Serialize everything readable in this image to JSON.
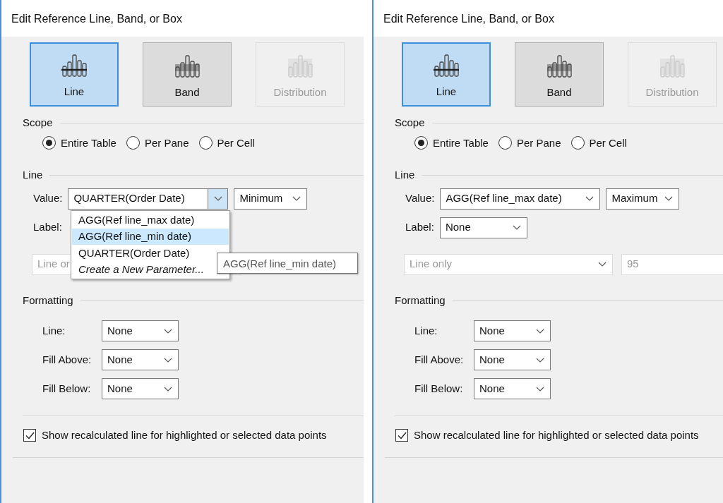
{
  "dialogs": [
    {
      "title": "Edit Reference Line, Band, or Box",
      "types": [
        {
          "kind": "line",
          "label": "Line",
          "selected": true,
          "disabled": false
        },
        {
          "kind": "band",
          "label": "Band",
          "selected": false,
          "disabled": false
        },
        {
          "kind": "distribution",
          "label": "Distribution",
          "selected": false,
          "disabled": true
        }
      ],
      "scope": {
        "title": "Scope",
        "options": [
          {
            "label": "Entire Table",
            "selected": true
          },
          {
            "label": "Per Pane",
            "selected": false
          },
          {
            "label": "Per Cell",
            "selected": false
          }
        ]
      },
      "line": {
        "title": "Line",
        "value_label": "Value:",
        "value": {
          "text": "QUARTER(Order Date)",
          "open": true
        },
        "aggregation": "Minimum",
        "label_label": "Label:",
        "menu": [
          {
            "kind": "option",
            "text": "AGG(Ref line_max date)",
            "selected": false
          },
          {
            "kind": "option",
            "text": "AGG(Ref line_min date)",
            "selected": true
          },
          {
            "kind": "option",
            "text": "QUARTER(Order Date)",
            "selected": false
          },
          {
            "kind": "action",
            "text": "Create a New Parameter...",
            "selected": false
          }
        ],
        "tooltip": "AGG(Ref line_min date)",
        "style_field": {
          "text": "Line or",
          "disabled": true
        }
      },
      "formatting": {
        "title": "Formatting",
        "rows": [
          {
            "label": "Line:",
            "value": "None"
          },
          {
            "label": "Fill Above:",
            "value": "None"
          },
          {
            "label": "Fill Below:",
            "value": "None"
          }
        ]
      },
      "recalc": {
        "label": "Show recalculated line for highlighted or selected data points",
        "checked": true
      }
    },
    {
      "title": "Edit Reference Line, Band, or Box",
      "types": [
        {
          "kind": "line",
          "label": "Line",
          "selected": true,
          "disabled": false
        },
        {
          "kind": "band",
          "label": "Band",
          "selected": false,
          "disabled": false
        },
        {
          "kind": "distribution",
          "label": "Distribution",
          "selected": false,
          "disabled": true
        }
      ],
      "scope": {
        "title": "Scope",
        "options": [
          {
            "label": "Entire Table",
            "selected": true
          },
          {
            "label": "Per Pane",
            "selected": false
          },
          {
            "label": "Per Cell",
            "selected": false
          }
        ]
      },
      "line": {
        "title": "Line",
        "value_label": "Value:",
        "value": {
          "text": "AGG(Ref line_max date)",
          "open": false
        },
        "aggregation": "Maximum",
        "label_label": "Label:",
        "label_value": "None",
        "style_field": {
          "text": "Line only",
          "disabled": true
        },
        "percent_field": {
          "text": "95",
          "disabled": true
        }
      },
      "formatting": {
        "title": "Formatting",
        "rows": [
          {
            "label": "Line:",
            "value": "None"
          },
          {
            "label": "Fill Above:",
            "value": "None"
          },
          {
            "label": "Fill Below:",
            "value": "None"
          }
        ]
      },
      "recalc": {
        "label": "Show recalculated line for highlighted or selected data points",
        "checked": true
      }
    }
  ]
}
